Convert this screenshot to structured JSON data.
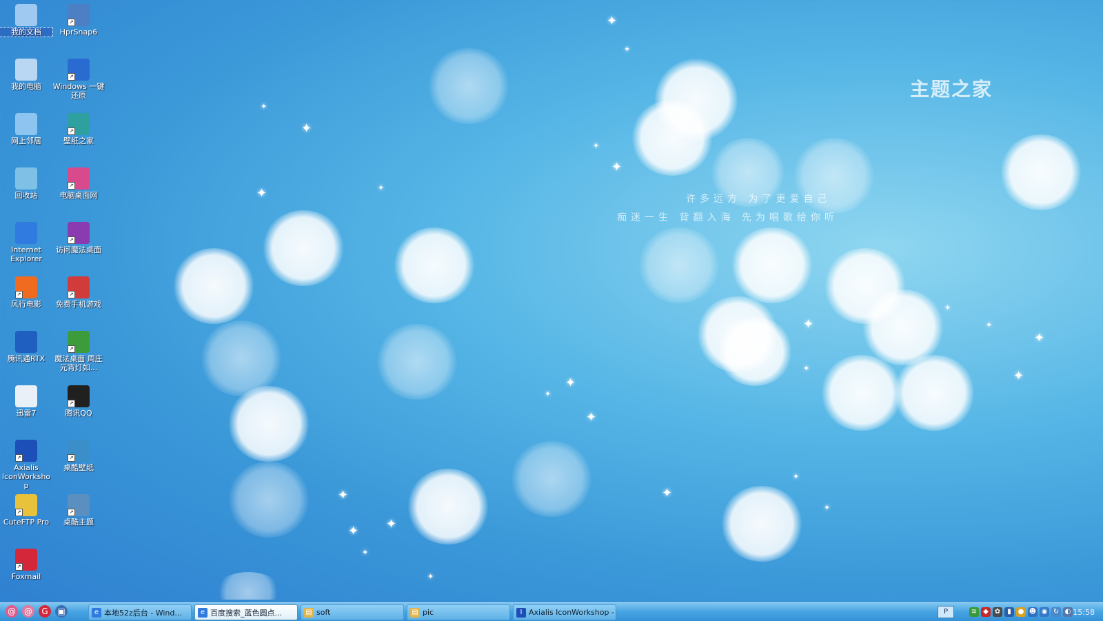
{
  "wallpaper": {
    "brand": "主题之家",
    "poem_line1": "许多远方  为了更爱自己",
    "poem_line2": "痴迷一生  背翻入海  先为唱歌给你听"
  },
  "desktop_icons": [
    {
      "label": "我的文档",
      "icon": "folder-icon",
      "color": "#9fc9f0",
      "shortcut": false,
      "selected": true
    },
    {
      "label": "HprSnap6",
      "icon": "camera-icon",
      "color": "#4c7fc4",
      "shortcut": true
    },
    {
      "label": "我的电脑",
      "icon": "computer-icon",
      "color": "#b9d7f3",
      "shortcut": false
    },
    {
      "label": "Windows 一键还原",
      "icon": "restore-icon",
      "color": "#2a6bd1",
      "shortcut": true
    },
    {
      "label": "网上邻居",
      "icon": "network-icon",
      "color": "#8ec4f0",
      "shortcut": false
    },
    {
      "label": "壁纸之家",
      "icon": "wallpaper-app-icon",
      "color": "#2fa0a0",
      "shortcut": true
    },
    {
      "label": "回收站",
      "icon": "recycle-bin-icon",
      "color": "#7fc1e6",
      "shortcut": false
    },
    {
      "label": "电脑桌面网",
      "icon": "desktop-site-icon",
      "color": "#d84a8c",
      "shortcut": true
    },
    {
      "label": "Internet Explorer",
      "icon": "ie-icon",
      "color": "#2f7be0",
      "shortcut": false
    },
    {
      "label": "访问魔法桌面",
      "icon": "magic-hat-icon",
      "color": "#8a3bb0",
      "shortcut": true
    },
    {
      "label": "风行电影",
      "icon": "movie-icon",
      "color": "#f06a20",
      "shortcut": true
    },
    {
      "label": "免费手机游戏",
      "icon": "game-icon",
      "color": "#d23b3b",
      "shortcut": true
    },
    {
      "label": "腾讯通RTX",
      "icon": "rtx-icon",
      "color": "#1f5fbf",
      "shortcut": false
    },
    {
      "label": "魔法桌面 周庄元宵灯如...",
      "icon": "magic-desktop-icon",
      "color": "#3c9c3c",
      "shortcut": true
    },
    {
      "label": "迅雷7",
      "icon": "thunder-icon",
      "color": "#eaf0f7",
      "shortcut": false
    },
    {
      "label": "腾讯QQ",
      "icon": "qq-icon",
      "color": "#202020",
      "shortcut": true
    },
    {
      "label": "Axialis IconWorkshop",
      "icon": "axialis-icon",
      "color": "#1d4fb8",
      "shortcut": true
    },
    {
      "label": "桌酷壁纸",
      "icon": "zhuoku-wallpaper-icon",
      "color": "#3a8fc9",
      "shortcut": true
    },
    {
      "label": "CuteFTP Pro",
      "icon": "ftp-icon",
      "color": "#e8c23a",
      "shortcut": true
    },
    {
      "label": "桌酷主题",
      "icon": "zhuoku-theme-icon",
      "color": "#5a8fc0",
      "shortcut": true
    },
    {
      "label": "Foxmail",
      "icon": "foxmail-icon",
      "color": "#d4283a",
      "shortcut": true
    }
  ],
  "taskbar": {
    "quick_launch": [
      {
        "icon": "spiral-icon",
        "glyph": "@",
        "color": "#e05a8a"
      },
      {
        "icon": "spiral-icon",
        "glyph": "@",
        "color": "#e07aa0"
      },
      {
        "icon": "foxmail-quick-icon",
        "glyph": "G",
        "color": "#d4283a"
      },
      {
        "icon": "window-quick-icon",
        "glyph": "▣",
        "color": "#3a6fb5"
      }
    ],
    "tasks": [
      {
        "label": "本地52z后台 - Wind...",
        "icon": "ie-icon",
        "glyph": "e",
        "color": "#2f7be0",
        "active": false
      },
      {
        "label": "百度搜索_蓝色圆点...",
        "icon": "ie-icon",
        "glyph": "e",
        "color": "#2f7be0",
        "active": true
      },
      {
        "label": "soft",
        "icon": "folder-icon",
        "glyph": "▤",
        "color": "#e2b54a",
        "active": false
      },
      {
        "label": "pic",
        "icon": "folder-icon",
        "glyph": "▤",
        "color": "#e2b54a",
        "active": false
      },
      {
        "label": "Axialis IconWorkshop -",
        "icon": "axialis-icon",
        "glyph": "I",
        "color": "#1d4fb8",
        "active": false
      }
    ],
    "tray_button": "P",
    "tray_icons": [
      {
        "icon": "tray-network-icon",
        "glyph": "≋",
        "color": "#3a9a3a"
      },
      {
        "icon": "tray-shield-icon",
        "glyph": "◆",
        "color": "#c42a2a"
      },
      {
        "icon": "tray-gear-icon",
        "glyph": "✿",
        "color": "#4a4a4a"
      },
      {
        "icon": "tray-display-icon",
        "glyph": "▮",
        "color": "#2a5fa8"
      },
      {
        "icon": "tray-qq-icon",
        "glyph": "●",
        "color": "#d9a020"
      },
      {
        "icon": "tray-user-icon",
        "glyph": "☻",
        "color": "#2f6fc0"
      },
      {
        "icon": "tray-globe-icon",
        "glyph": "◉",
        "color": "#3478c8"
      },
      {
        "icon": "tray-sync-icon",
        "glyph": "↻",
        "color": "#4a88c8"
      },
      {
        "icon": "tray-volume-icon",
        "glyph": "◐",
        "color": "#5577aa"
      }
    ],
    "clock": "15:58"
  }
}
